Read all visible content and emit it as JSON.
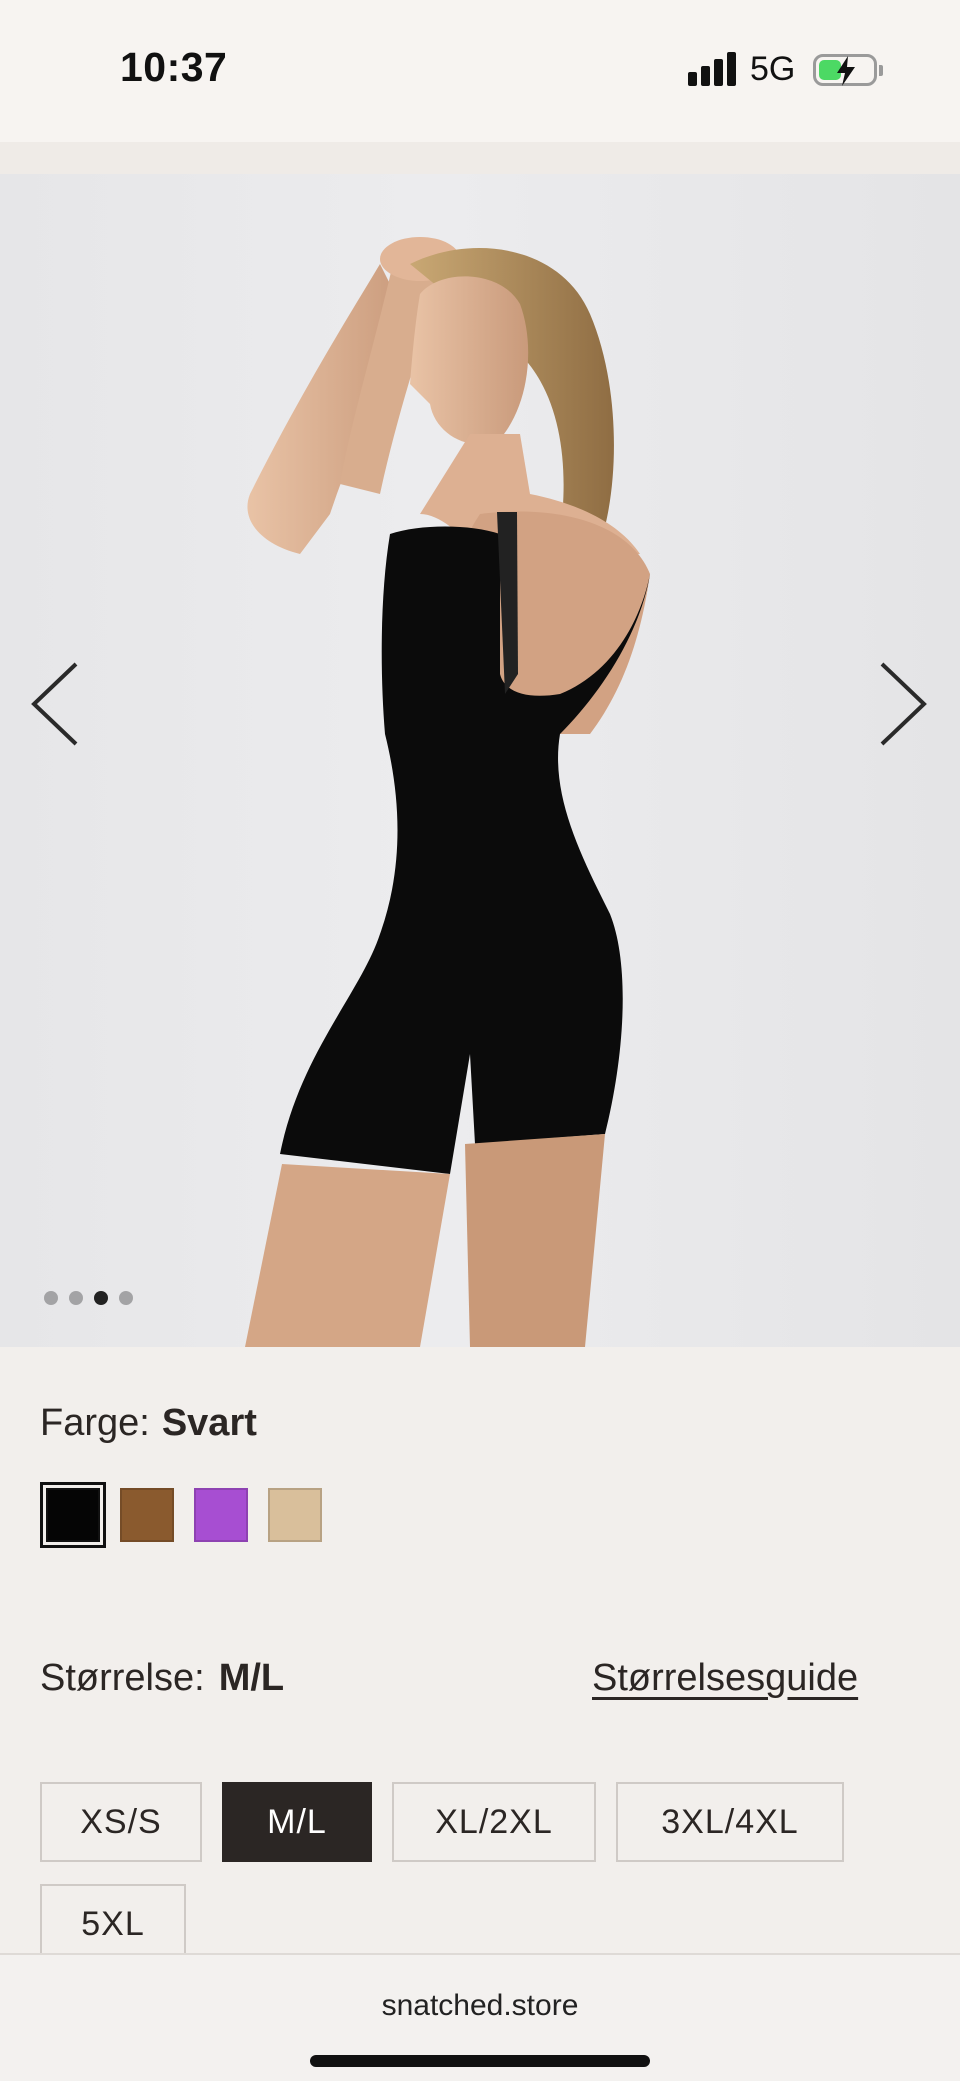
{
  "status_bar": {
    "time": "10:37",
    "network": "5G",
    "icons": [
      "signal-icon",
      "battery-charging-icon"
    ]
  },
  "gallery": {
    "icons": [
      "chevron-left-icon",
      "chevron-right-icon"
    ],
    "image_count": 4,
    "active_index": 2
  },
  "color": {
    "label": "Farge:",
    "value": "Svart",
    "swatches": [
      {
        "name": "black",
        "hex": "#050505",
        "selected": true
      },
      {
        "name": "brown",
        "hex": "#8a5a2e",
        "selected": false
      },
      {
        "name": "purple",
        "hex": "#a74ed2",
        "selected": false
      },
      {
        "name": "beige",
        "hex": "#d9bf9b",
        "selected": false
      }
    ]
  },
  "size": {
    "label": "Størrelse:",
    "value": "M/L",
    "guide_link": "Størrelsesguide",
    "options": [
      "XS/S",
      "M/L",
      "XL/2XL",
      "3XL/4XL",
      "5XL"
    ],
    "selected": "M/L"
  },
  "browser": {
    "url": "snatched.store"
  }
}
